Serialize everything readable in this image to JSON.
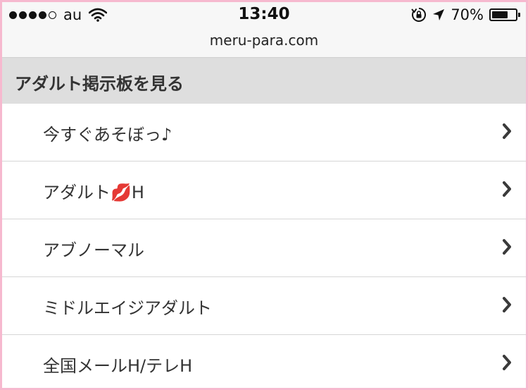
{
  "status_bar": {
    "carrier": "au",
    "time": "13:40",
    "battery": "70%",
    "battery_level": 0.7,
    "signal_bars_filled": 4,
    "signal_bars_total": 5
  },
  "browser": {
    "url": "meru-para.com"
  },
  "section": {
    "title": "アダルト掲示板を見る"
  },
  "menu": {
    "items": [
      {
        "label": "今すぐあそぼっ♪"
      },
      {
        "label": "アダルト💋H"
      },
      {
        "label": "アブノーマル"
      },
      {
        "label": "ミドルエイジアダルト"
      },
      {
        "label": "全国メールH/テレH"
      }
    ]
  },
  "colors": {
    "frame_border": "#f6b9cf",
    "header_bg": "#dedede",
    "text": "#333333"
  }
}
